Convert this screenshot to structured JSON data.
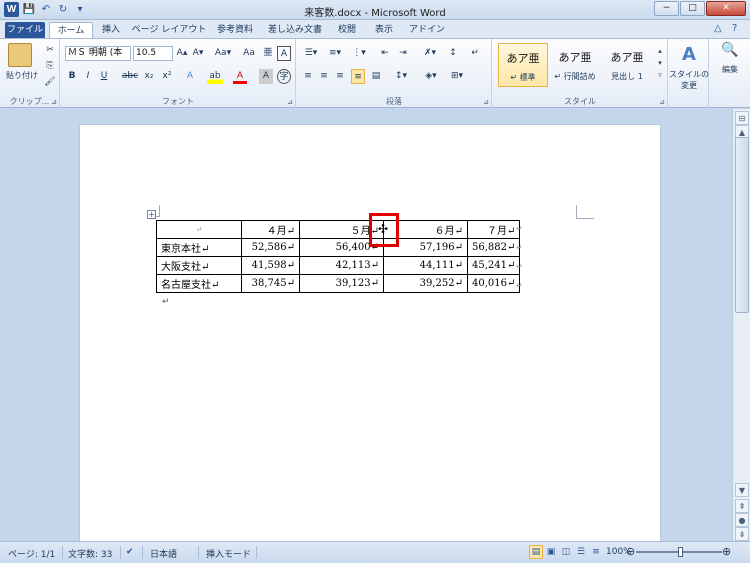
{
  "window": {
    "title": "来客数.docx - Microsoft Word",
    "minimize": "−",
    "restore": "□",
    "close": "✕"
  },
  "qat": {
    "logo": "W",
    "save": "💾",
    "undo": "↶",
    "redo": "↻",
    "customize": "▾"
  },
  "tabs": [
    "ファイル",
    "ホーム",
    "挿入",
    "ページ レイアウト",
    "参考資料",
    "差し込み文書",
    "校閲",
    "表示",
    "アドイン"
  ],
  "tab_right": {
    "minimize_ribbon": "△",
    "help": "?"
  },
  "ribbon": {
    "clipboard": {
      "paste": "貼り付け",
      "label": "クリップ..."
    },
    "font": {
      "font_name": "ＭＳ 明朝 (本",
      "font_size": "10.5",
      "grow": "A▴",
      "shrink": "A▾",
      "case": "Aa▾",
      "clear": "Aa",
      "phonetic": "亜",
      "border": "A",
      "bold": "B",
      "italic": "I",
      "underline": "U",
      "strike": "abc",
      "sub": "x₂",
      "sup": "x²",
      "effects": "A",
      "highlight": "ab",
      "color": "A",
      "shade": "A",
      "enclose": "字",
      "label": "フォント"
    },
    "paragraph": {
      "label": "段落"
    },
    "styles": {
      "items": [
        {
          "sample": "あア亜",
          "name": "↵ 標準"
        },
        {
          "sample": "あア亜",
          "name": "↵ 行間詰め"
        },
        {
          "sample": "あア亜",
          "name": "見出し 1"
        }
      ],
      "change": "スタイルの\n変更",
      "label": "スタイル"
    },
    "editing": {
      "label": "編集"
    }
  },
  "table": {
    "header": [
      "↵",
      "４月↵",
      "５月↵",
      "６月↵",
      "７月↵"
    ],
    "rows": [
      [
        "東京本社↵",
        "52,586↵",
        "56,400↵",
        "57,196↵",
        "56,882↵"
      ],
      [
        "大阪支社↵",
        "41,598↵",
        "42,113↵",
        "44,111↵",
        "45,241↵"
      ],
      [
        "名古屋支社↵",
        "38,745↵",
        "39,123↵",
        "39,252↵",
        "40,016↵"
      ]
    ],
    "row_end_mark": "↵"
  },
  "doc": {
    "para_mark": "↵",
    "move_handle": "+",
    "cursor": "✣"
  },
  "statusbar": {
    "page": "ページ: 1/1",
    "words": "文字数: 33",
    "lang": "日本語",
    "mode": "挿入モード",
    "zoom": "100%",
    "zoom_out": "⊖",
    "zoom_in": "⊕"
  },
  "colors": {
    "accent": "#2b579a",
    "highlight_box": "#e00000"
  }
}
